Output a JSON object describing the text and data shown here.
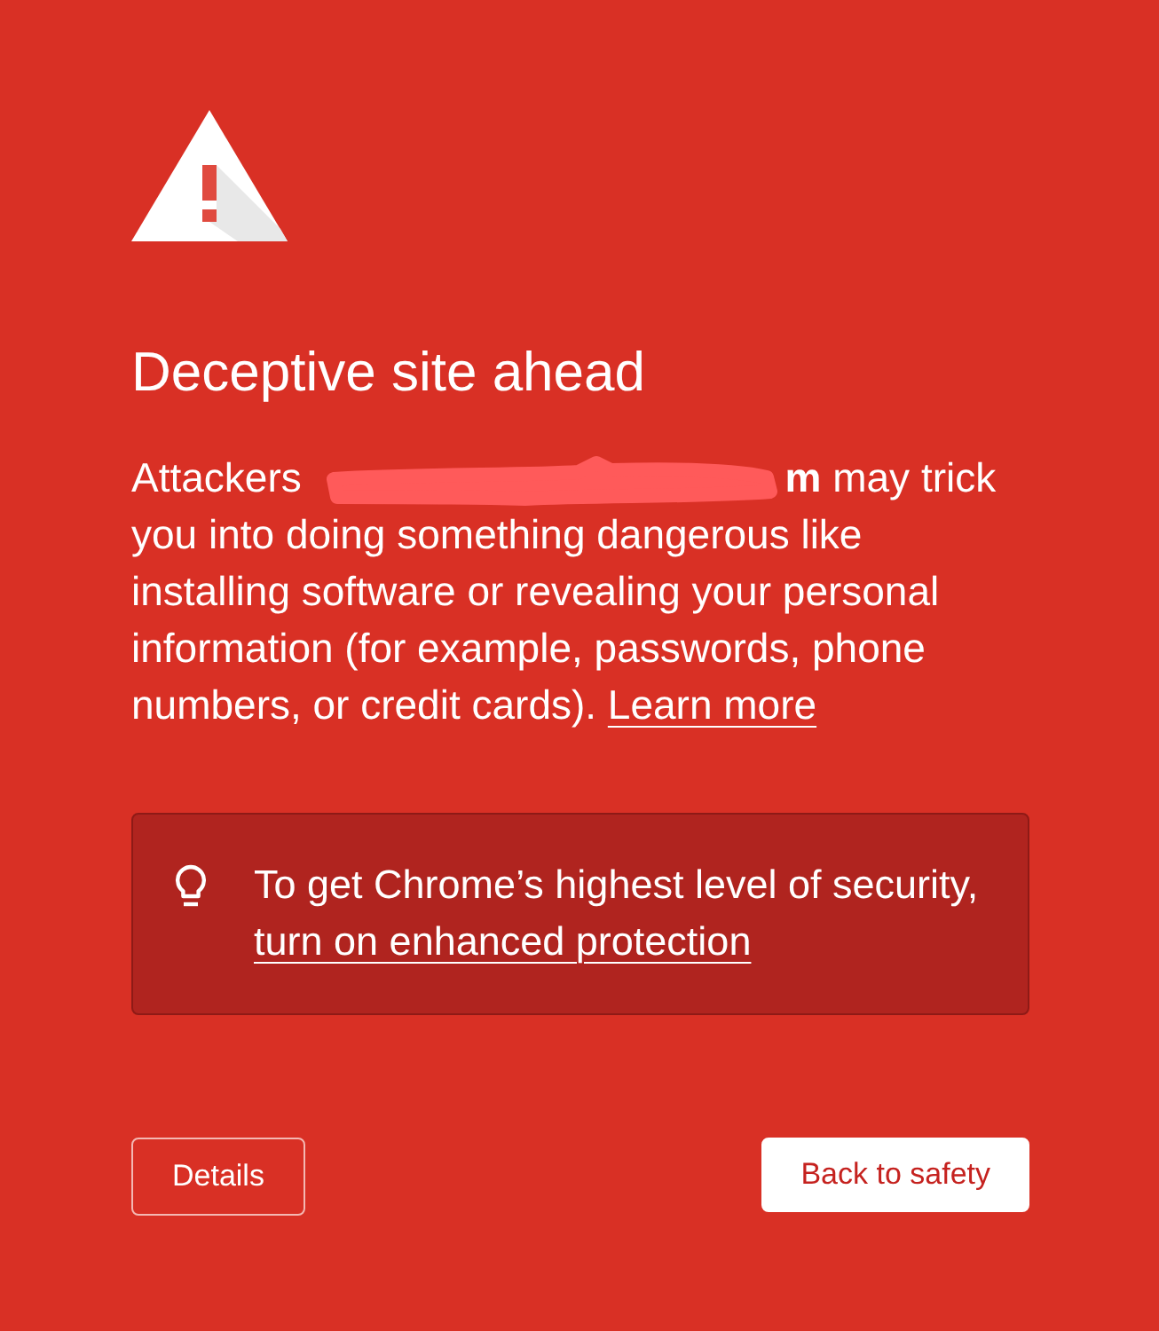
{
  "warning": {
    "title": "Deceptive site ahead",
    "message": {
      "before": "Attackers",
      "redacted": true,
      "after": "**m** may trick you into doing something dangerous like installing software or revealing your personal information (for example, passwords, phone numbers, or credit cards).",
      "link": "Learn more"
    }
  },
  "banner": {
    "text": "To get Chrome’s highest level of security,",
    "link": "turn on enhanced protection"
  },
  "buttons": [
    {
      "label": "Details",
      "kind": "outline"
    },
    {
      "label": "Back to safety",
      "kind": "filled"
    }
  ]
}
